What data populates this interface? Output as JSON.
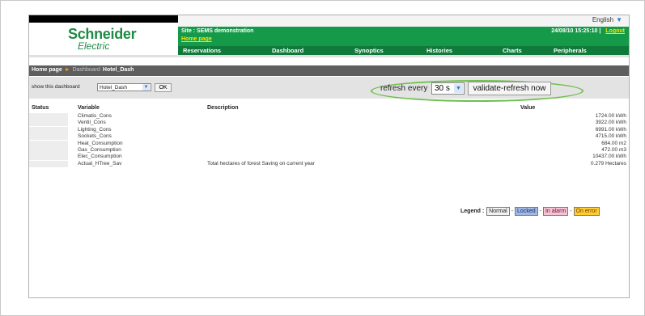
{
  "header": {
    "brand_name": "Schneider",
    "brand_sub": "Electric",
    "language": "English",
    "site_label": "Site : SEMS demonstration",
    "home_link": "Home page",
    "datetime": "24/08/10 15:25:10",
    "logout": "Logout"
  },
  "nav": {
    "items": [
      {
        "label": "Reservations"
      },
      {
        "label": "Dashboard"
      },
      {
        "label": "Synoptics"
      },
      {
        "label": "Histories"
      },
      {
        "label": "Charts"
      },
      {
        "label": "Peripherals"
      }
    ]
  },
  "breadcrumb": {
    "home": "Home page",
    "dashboard": "Dashboard",
    "current": "Hotel_Dash"
  },
  "controls": {
    "show_label": "show this dashboard",
    "dashboard_value": "Hotel_Dash",
    "ok_label": "OK",
    "refresh_label": "refresh every",
    "refresh_value": "30 s",
    "validate_label": "validate-refresh now"
  },
  "table": {
    "columns": {
      "status": "Status",
      "variable": "Variable",
      "description": "Description",
      "value": "Value"
    },
    "rows": [
      {
        "variable": "Climatis_Cons",
        "description": "",
        "value": "1724.00 kWh"
      },
      {
        "variable": "Ventil_Cons",
        "description": "",
        "value": "3922.00 kWh"
      },
      {
        "variable": "Lighting_Cons",
        "description": "",
        "value": "6991.00 kWh"
      },
      {
        "variable": "Sockets_Cons",
        "description": "",
        "value": "4715.00 kWh"
      },
      {
        "variable": "Heat_Consumption",
        "description": "",
        "value": "684.00 m2"
      },
      {
        "variable": "Gas_Consumption",
        "description": "",
        "value": "472.00 m3"
      },
      {
        "variable": "Elec_Consumption",
        "description": "",
        "value": "10437.00 kWh"
      },
      {
        "variable": "Actual_HTree_Sav",
        "description": "Total hectares of forest Saving on current year",
        "value": "0.279 Hectares"
      }
    ]
  },
  "legend": {
    "label": "Legend :",
    "normal": "Normal",
    "locked": "Locked",
    "in_alarm": "In alarm",
    "on_error": "On error"
  },
  "colors": {
    "brand_green": "#159a49",
    "nav_green": "#0f7a3a",
    "highlight_oval": "#6cc04a",
    "locked": "#9fb8e6",
    "in_alarm": "#f4c4d6",
    "on_error": "#ffcc33"
  }
}
